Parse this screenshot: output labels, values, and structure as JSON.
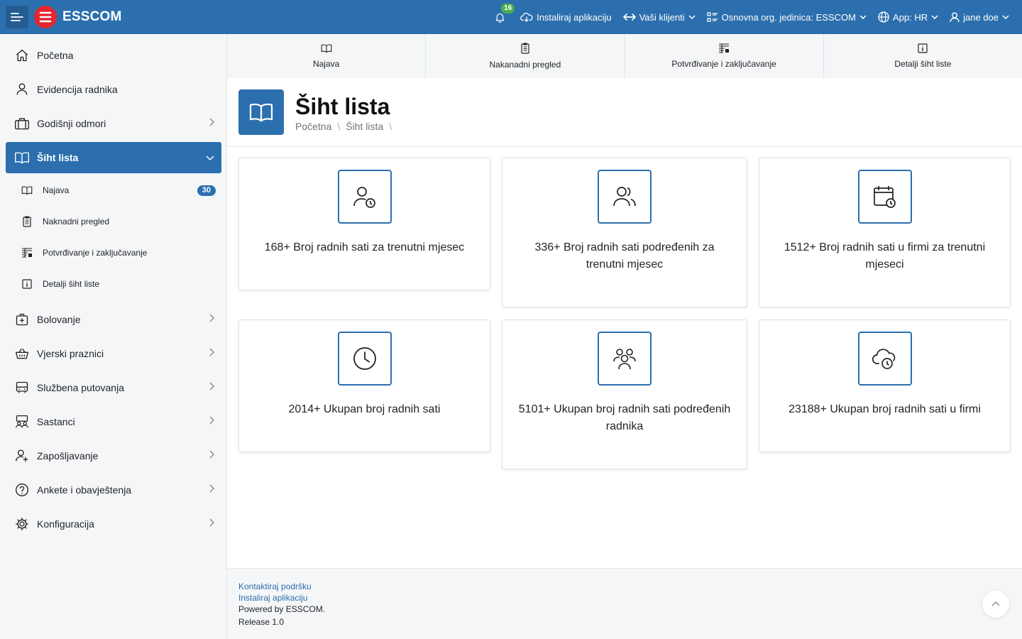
{
  "topbar": {
    "brand": "ESSCOM",
    "notifications_count": "16",
    "install_app": "Instaliraj aplikaciju",
    "clients": "Vaši klijenti",
    "org_unit": "Osnovna org. jedinica: ESSCOM",
    "app": "App: HR",
    "user": "jane doe"
  },
  "sidebar": {
    "items": [
      {
        "label": "Početna",
        "icon": "home-icon"
      },
      {
        "label": "Evidencija radnika",
        "icon": "person-icon"
      },
      {
        "label": "Godišnji odmori",
        "icon": "luggage-icon"
      },
      {
        "label": "Šiht lista",
        "icon": "book-icon"
      },
      {
        "label": "Bolovanje",
        "icon": "medical-bag-icon"
      },
      {
        "label": "Vjerski praznici",
        "icon": "basket-icon"
      },
      {
        "label": "Službena putovanja",
        "icon": "bus-icon"
      },
      {
        "label": "Sastanci",
        "icon": "meeting-icon"
      },
      {
        "label": "Zapošljavanje",
        "icon": "person-add-icon"
      },
      {
        "label": "Ankete i obavještenja",
        "icon": "question-circle-icon"
      },
      {
        "label": "Konfiguracija",
        "icon": "gear-icon"
      }
    ],
    "sub_items": [
      {
        "label": "Najava",
        "badge": "30"
      },
      {
        "label": "Naknadni pregled"
      },
      {
        "label": "Potvrđivanje i zaključavanje"
      },
      {
        "label": "Detalji šiht liste"
      }
    ]
  },
  "tabs": [
    {
      "label": "Najava"
    },
    {
      "label": "Nakanadni pregled"
    },
    {
      "label": "Potvrđivanje i zaključavanje"
    },
    {
      "label": "Detalji šiht liste"
    }
  ],
  "page": {
    "title": "Šiht lista",
    "breadcrumb": [
      "Početna",
      "Šiht lista"
    ]
  },
  "cards": [
    {
      "text": "168+ Broj radnih sati za trenutni mjesec",
      "icon": "person-clock-icon"
    },
    {
      "text": "336+ Broj radnih sati podređenih za trenutni mjesec",
      "icon": "people-icon"
    },
    {
      "text": "1512+ Broj radnih sati u firmi za trenutni mjeseci",
      "icon": "calendar-clock-icon"
    },
    {
      "text": "2014+ Ukupan broj radnih sati",
      "icon": "clock-icon"
    },
    {
      "text": "5101+ Ukupan broj radnih sati podređenih radnika",
      "icon": "group-icon"
    },
    {
      "text": "23188+ Ukupan broj radnih sati u firmi",
      "icon": "cloud-clock-icon"
    }
  ],
  "footer": {
    "contact": "Kontaktiraj podršku",
    "install": "Instaliraj aplikaciju",
    "powered": "Powered by ESSCOM.",
    "release": "Release 1.0"
  },
  "colors": {
    "primary": "#2c6fae",
    "logo_red": "#e3262f",
    "badge_green": "#4caf50"
  }
}
